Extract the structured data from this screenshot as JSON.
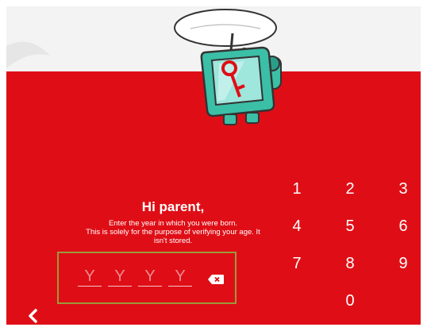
{
  "header": {
    "greeting": "Hi parent,",
    "instructions": [
      "Enter the year in which you were born.",
      "This is solely for the purpose of verifying your age. It",
      "isn't stored."
    ]
  },
  "pin": {
    "placeholders": [
      "Y",
      "Y",
      "Y",
      "Y"
    ]
  },
  "keypad": {
    "keys": [
      "1",
      "2",
      "3",
      "4",
      "5",
      "6",
      "7",
      "8",
      "9",
      "0"
    ]
  },
  "colors": {
    "background_red": "#df0e16",
    "box_border": "#9b9a3c",
    "mascot_teal": "#3bbfa7"
  },
  "icons": {
    "back": "chevron-left-icon",
    "backspace": "backspace-icon",
    "mascot": "tv-robot-mascot-icon"
  }
}
